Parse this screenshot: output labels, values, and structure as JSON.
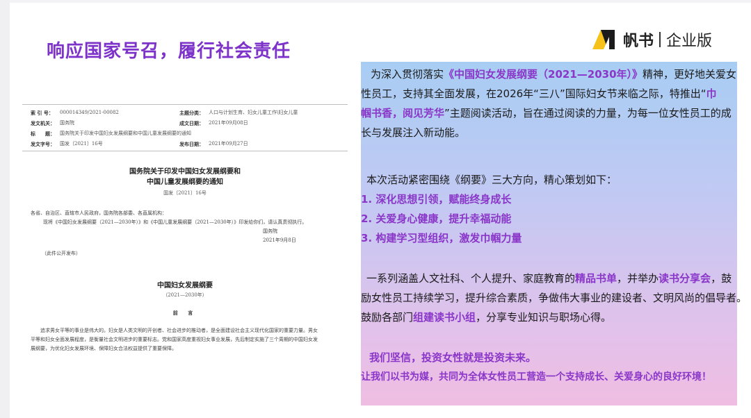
{
  "header": {
    "title": "响应国家号召，履行社会责任",
    "logo_brand": "帆书",
    "logo_edition": "企业版"
  },
  "document": {
    "meta": [
      {
        "k1": "索 引 号：",
        "v1": "000014349/2021-00082",
        "k2": "主题分类：",
        "v2": "人口与计划生育、妇女儿童工作\\妇女儿童"
      },
      {
        "k1": "发文机关：",
        "v1": "国务院",
        "k2": "成文日期：",
        "v2": "2021年09月08日"
      },
      {
        "k1": "标　　题：",
        "v1": "国务院关于印发中国妇女发展纲要和中国儿童发展纲要的通知",
        "k2": "",
        "v2": ""
      },
      {
        "k1": "发文字号：",
        "v1": "国发〔2021〕16号",
        "k2": "发布日期：",
        "v2": "2021年09月27日"
      }
    ],
    "title_line1": "国务院关于印发中国妇女发展纲要和",
    "title_line2": "中国儿童发展纲要的通知",
    "doc_no": "国发〔2021〕16号",
    "address": "各省、自治区、直辖市人民政府，国务院各部委、各直属机构：",
    "body": "现将《中国妇女发展纲要（2021—2030年）》和《中国儿童发展纲要（2021—2030年）》印发给你们，请认真贯彻执行。",
    "signer": "国务院",
    "date": "2021年9月8日",
    "public_note": "（此件公开发布）",
    "section_title": "中国妇女发展纲要",
    "section_sub": "（2021—2030年）",
    "preface": "前 言",
    "para_line1": "追求男女平等的事业是伟大的。妇女是人类文明的开创者、社会进步的推动者，是全面建设社会主义现代化国家的重要力量。男女",
    "para_line2": "平等和妇女全面发展程度，是衡量社会文明进步的重要标志。党和国家高度重视妇女事业发展，先后制定实施了三个周期的中国妇女发",
    "para_line3": "展纲要，为优化妇女发展环境、保障妇女合法权益提供了重要保障。"
  },
  "panel": {
    "p1_l1_a": "为深入贯彻落实",
    "p1_l1_em": "《中国妇女发展纲要（2021—2030年）》",
    "p1_l1_b": "精神，更好地关爱女",
    "p1_l2_a": "性员工，支持其全面发展，在2026年“三八”国际妇女节来临之际，特推出“",
    "p1_l2_em": "巾",
    "p1_l3_em": "帼书香，阅见芳华",
    "p1_l3_b": "”主题阅读活动，旨在通过阅读的力量，为每一位女性员工的成",
    "p1_l4": "长与发展注入新动能。",
    "p2_intro": "本次活动紧密围绕《纲要》三大方向，精心策划如下：",
    "items": [
      "1. 深化思想引领，赋能终身成长",
      "2. 关爱身心健康，提升幸福动能",
      "3. 构建学习型组织，激发巾帼力量"
    ],
    "p3_l1_a": "一系列涵盖人文社科、个人提升、家庭教育的",
    "p3_l1_em1": "精品书单",
    "p3_l1_b": "，并举办",
    "p3_l1_em2": "读书分享会",
    "p3_l1_c": "，鼓",
    "p3_l2": "励女性员工持续学习，提升综合素质，争做伟大事业的建设者、文明风尚的倡导者。",
    "p3_l3_a": "鼓励各部门",
    "p3_l3_em": "组建读书小组",
    "p3_l3_b": "，分享专业知识与职场心得。",
    "closing1": "我们坚信，投资女性就是投资未来。",
    "closing2": "让我们以书为媒，共同为全体女性员工营造一个支持成长、关爱身心的良好环境！"
  }
}
